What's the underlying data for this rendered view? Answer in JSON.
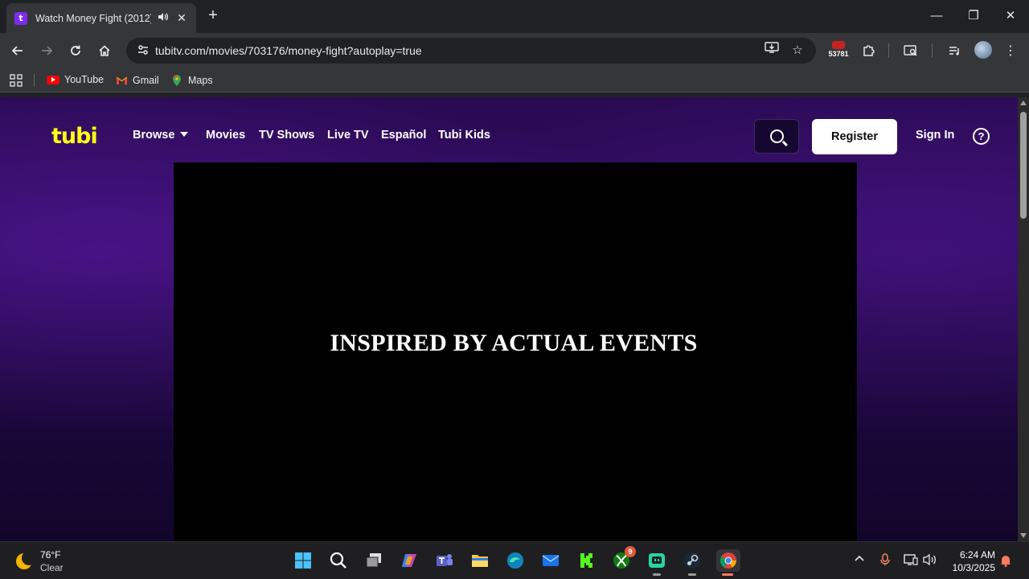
{
  "browser": {
    "tab": {
      "title": "Watch Money Fight (2012) ",
      "favicon_text": "t"
    },
    "url": "tubitv.com/movies/703176/money-fight?autoplay=true",
    "extension_badge": "53781",
    "bookmarks": [
      {
        "label": "YouTube",
        "icon": "youtube-icon"
      },
      {
        "label": "Gmail",
        "icon": "gmail-icon"
      },
      {
        "label": "Maps",
        "icon": "maps-icon"
      }
    ]
  },
  "site": {
    "logo": "tubi",
    "nav": {
      "browse": "Browse",
      "movies": "Movies",
      "tv_shows": "TV Shows",
      "live_tv": "Live TV",
      "espanol": "Español",
      "tubi_kids": "Tubi Kids"
    },
    "register": "Register",
    "sign_in": "Sign In",
    "help": "?",
    "player_caption": "INSPIRED BY ACTUAL EVENTS",
    "colors": {
      "logo": "#ffff13",
      "background": "#2a0a52"
    }
  },
  "taskbar": {
    "weather": {
      "temp": "76°F",
      "condition": "Clear"
    },
    "xbox_badge": "9",
    "time": "6:24 AM",
    "date": "10/3/2025"
  }
}
